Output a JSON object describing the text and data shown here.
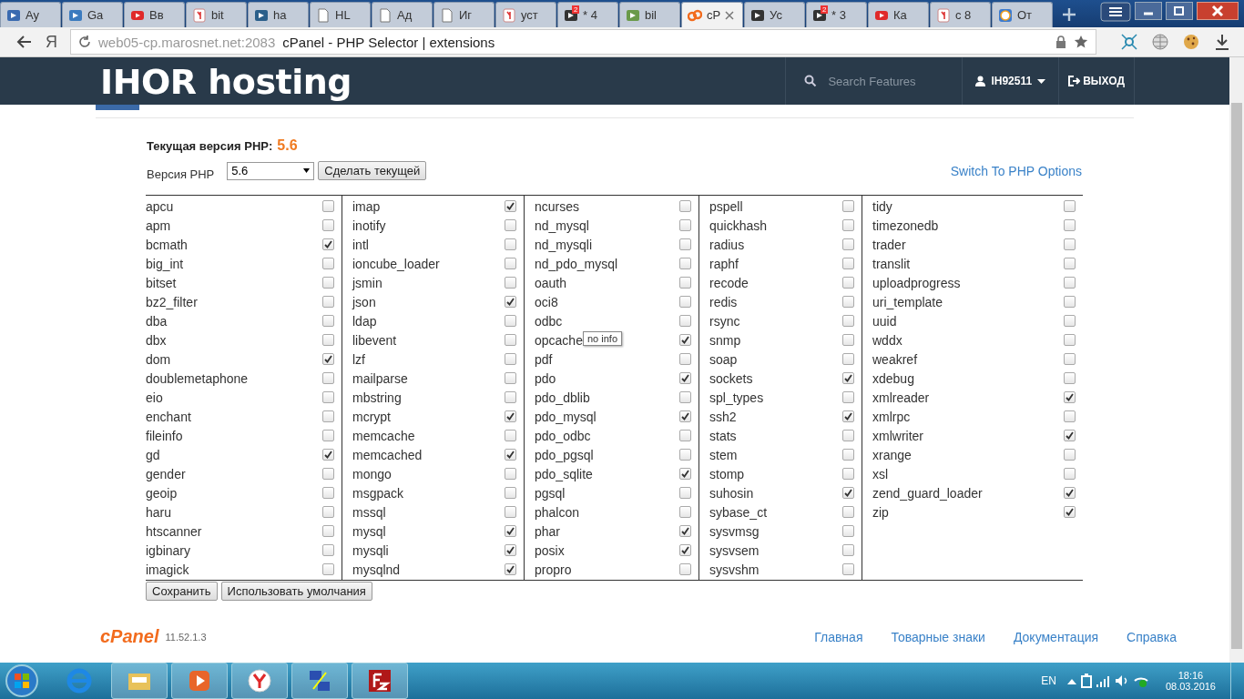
{
  "browser": {
    "tabs": [
      {
        "label": "Ay",
        "kind": "play",
        "selected": false
      },
      {
        "label": "Ga",
        "kind": "runner",
        "selected": false
      },
      {
        "label": "Вв",
        "kind": "video",
        "selected": false
      },
      {
        "label": "bit",
        "kind": "yandex",
        "selected": false
      },
      {
        "label": "ha",
        "kind": "bucket",
        "selected": false
      },
      {
        "label": "HL",
        "kind": "page",
        "selected": false
      },
      {
        "label": "Ад",
        "kind": "page",
        "selected": false
      },
      {
        "label": "Иг",
        "kind": "page",
        "selected": false
      },
      {
        "label": "уст",
        "kind": "yandex",
        "selected": false
      },
      {
        "label": "* 4",
        "kind": "mail",
        "badge": "2",
        "selected": false
      },
      {
        "label": "bil",
        "kind": "tree",
        "selected": false
      },
      {
        "label": "cP",
        "kind": "cpanel",
        "selected": true
      },
      {
        "label": "Ус",
        "kind": "ninja",
        "selected": false
      },
      {
        "label": "* 3",
        "kind": "mail",
        "badge": "2",
        "selected": false
      },
      {
        "label": "Ка",
        "kind": "video",
        "selected": false
      },
      {
        "label": "с 8",
        "kind": "yandex",
        "selected": false
      },
      {
        "label": "От",
        "kind": "question",
        "selected": false
      }
    ],
    "address": {
      "host": "web05-cp.marosnet.net:2083",
      "title": "cPanel - PHP Selector | extensions"
    },
    "yandex_button": "Я"
  },
  "header": {
    "logo": "IHOR hosting",
    "search": {
      "placeholder": "Search Features"
    },
    "user": "IH92511",
    "logout": "ВЫХОД"
  },
  "php": {
    "current_label": "Текущая версия PHP:",
    "current_value": "5.6",
    "version_label": "Версия PHP",
    "version_value": "5.6",
    "set_button": "Сделать текущей",
    "switch_link": "Switch To PHP Options"
  },
  "extensions": {
    "columns": [
      [
        {
          "name": "apcu",
          "checked": false
        },
        {
          "name": "apm",
          "checked": false
        },
        {
          "name": "bcmath",
          "checked": true
        },
        {
          "name": "big_int",
          "checked": false
        },
        {
          "name": "bitset",
          "checked": false
        },
        {
          "name": "bz2_filter",
          "checked": false
        },
        {
          "name": "dba",
          "checked": false
        },
        {
          "name": "dbx",
          "checked": false
        },
        {
          "name": "dom",
          "checked": true
        },
        {
          "name": "doublemetaphone",
          "checked": false
        },
        {
          "name": "eio",
          "checked": false
        },
        {
          "name": "enchant",
          "checked": false
        },
        {
          "name": "fileinfo",
          "checked": false
        },
        {
          "name": "gd",
          "checked": true
        },
        {
          "name": "gender",
          "checked": false
        },
        {
          "name": "geoip",
          "checked": false
        },
        {
          "name": "haru",
          "checked": false
        },
        {
          "name": "htscanner",
          "checked": false
        },
        {
          "name": "igbinary",
          "checked": false
        },
        {
          "name": "imagick",
          "checked": false
        }
      ],
      [
        {
          "name": "imap",
          "checked": true
        },
        {
          "name": "inotify",
          "checked": false
        },
        {
          "name": "intl",
          "checked": false
        },
        {
          "name": "ioncube_loader",
          "checked": false
        },
        {
          "name": "jsmin",
          "checked": false
        },
        {
          "name": "json",
          "checked": true
        },
        {
          "name": "ldap",
          "checked": false
        },
        {
          "name": "libevent",
          "checked": false
        },
        {
          "name": "lzf",
          "checked": false
        },
        {
          "name": "mailparse",
          "checked": false
        },
        {
          "name": "mbstring",
          "checked": false
        },
        {
          "name": "mcrypt",
          "checked": true
        },
        {
          "name": "memcache",
          "checked": false
        },
        {
          "name": "memcached",
          "checked": true
        },
        {
          "name": "mongo",
          "checked": false
        },
        {
          "name": "msgpack",
          "checked": false
        },
        {
          "name": "mssql",
          "checked": false
        },
        {
          "name": "mysql",
          "checked": true
        },
        {
          "name": "mysqli",
          "checked": true
        },
        {
          "name": "mysqlnd",
          "checked": true
        }
      ],
      [
        {
          "name": "ncurses",
          "checked": false
        },
        {
          "name": "nd_mysql",
          "checked": false
        },
        {
          "name": "nd_mysqli",
          "checked": false
        },
        {
          "name": "nd_pdo_mysql",
          "checked": false
        },
        {
          "name": "oauth",
          "checked": false
        },
        {
          "name": "oci8",
          "checked": false
        },
        {
          "name": "odbc",
          "checked": false
        },
        {
          "name": "opcache",
          "checked": true,
          "tooltip": "no info"
        },
        {
          "name": "pdf",
          "checked": false
        },
        {
          "name": "pdo",
          "checked": true
        },
        {
          "name": "pdo_dblib",
          "checked": false
        },
        {
          "name": "pdo_mysql",
          "checked": true
        },
        {
          "name": "pdo_odbc",
          "checked": false
        },
        {
          "name": "pdo_pgsql",
          "checked": false
        },
        {
          "name": "pdo_sqlite",
          "checked": true
        },
        {
          "name": "pgsql",
          "checked": false
        },
        {
          "name": "phalcon",
          "checked": false
        },
        {
          "name": "phar",
          "checked": true
        },
        {
          "name": "posix",
          "checked": true
        },
        {
          "name": "propro",
          "checked": false
        }
      ],
      [
        {
          "name": "pspell",
          "checked": false
        },
        {
          "name": "quickhash",
          "checked": false
        },
        {
          "name": "radius",
          "checked": false
        },
        {
          "name": "raphf",
          "checked": false
        },
        {
          "name": "recode",
          "checked": false
        },
        {
          "name": "redis",
          "checked": false
        },
        {
          "name": "rsync",
          "checked": false
        },
        {
          "name": "snmp",
          "checked": false
        },
        {
          "name": "soap",
          "checked": false
        },
        {
          "name": "sockets",
          "checked": true
        },
        {
          "name": "spl_types",
          "checked": false
        },
        {
          "name": "ssh2",
          "checked": true
        },
        {
          "name": "stats",
          "checked": false
        },
        {
          "name": "stem",
          "checked": false
        },
        {
          "name": "stomp",
          "checked": false
        },
        {
          "name": "suhosin",
          "checked": true
        },
        {
          "name": "sybase_ct",
          "checked": false
        },
        {
          "name": "sysvmsg",
          "checked": false
        },
        {
          "name": "sysvsem",
          "checked": false
        },
        {
          "name": "sysvshm",
          "checked": false
        }
      ],
      [
        {
          "name": "tidy",
          "checked": false
        },
        {
          "name": "timezonedb",
          "checked": false
        },
        {
          "name": "trader",
          "checked": false
        },
        {
          "name": "translit",
          "checked": false
        },
        {
          "name": "uploadprogress",
          "checked": false
        },
        {
          "name": "uri_template",
          "checked": false
        },
        {
          "name": "uuid",
          "checked": false
        },
        {
          "name": "wddx",
          "checked": false
        },
        {
          "name": "weakref",
          "checked": false
        },
        {
          "name": "xdebug",
          "checked": false
        },
        {
          "name": "xmlreader",
          "checked": true
        },
        {
          "name": "xmlrpc",
          "checked": false
        },
        {
          "name": "xmlwriter",
          "checked": true
        },
        {
          "name": "xrange",
          "checked": false
        },
        {
          "name": "xsl",
          "checked": false
        },
        {
          "name": "zend_guard_loader",
          "checked": true
        },
        {
          "name": "zip",
          "checked": true
        }
      ]
    ]
  },
  "buttons": [
    "Сохранить",
    "Использовать умолчания"
  ],
  "footer": {
    "logo": "cPanel",
    "version": "11.52.1.3",
    "links": [
      "Главная",
      "Товарные знаки",
      "Документация",
      "Справка"
    ]
  },
  "taskbar": {
    "apps": [
      {
        "kind": "ie"
      },
      {
        "kind": "folder"
      },
      {
        "kind": "media"
      },
      {
        "kind": "yandex"
      },
      {
        "kind": "network"
      },
      {
        "kind": "filezilla"
      }
    ],
    "language": "EN",
    "time": "18:16",
    "date": "08.03.2016"
  }
}
